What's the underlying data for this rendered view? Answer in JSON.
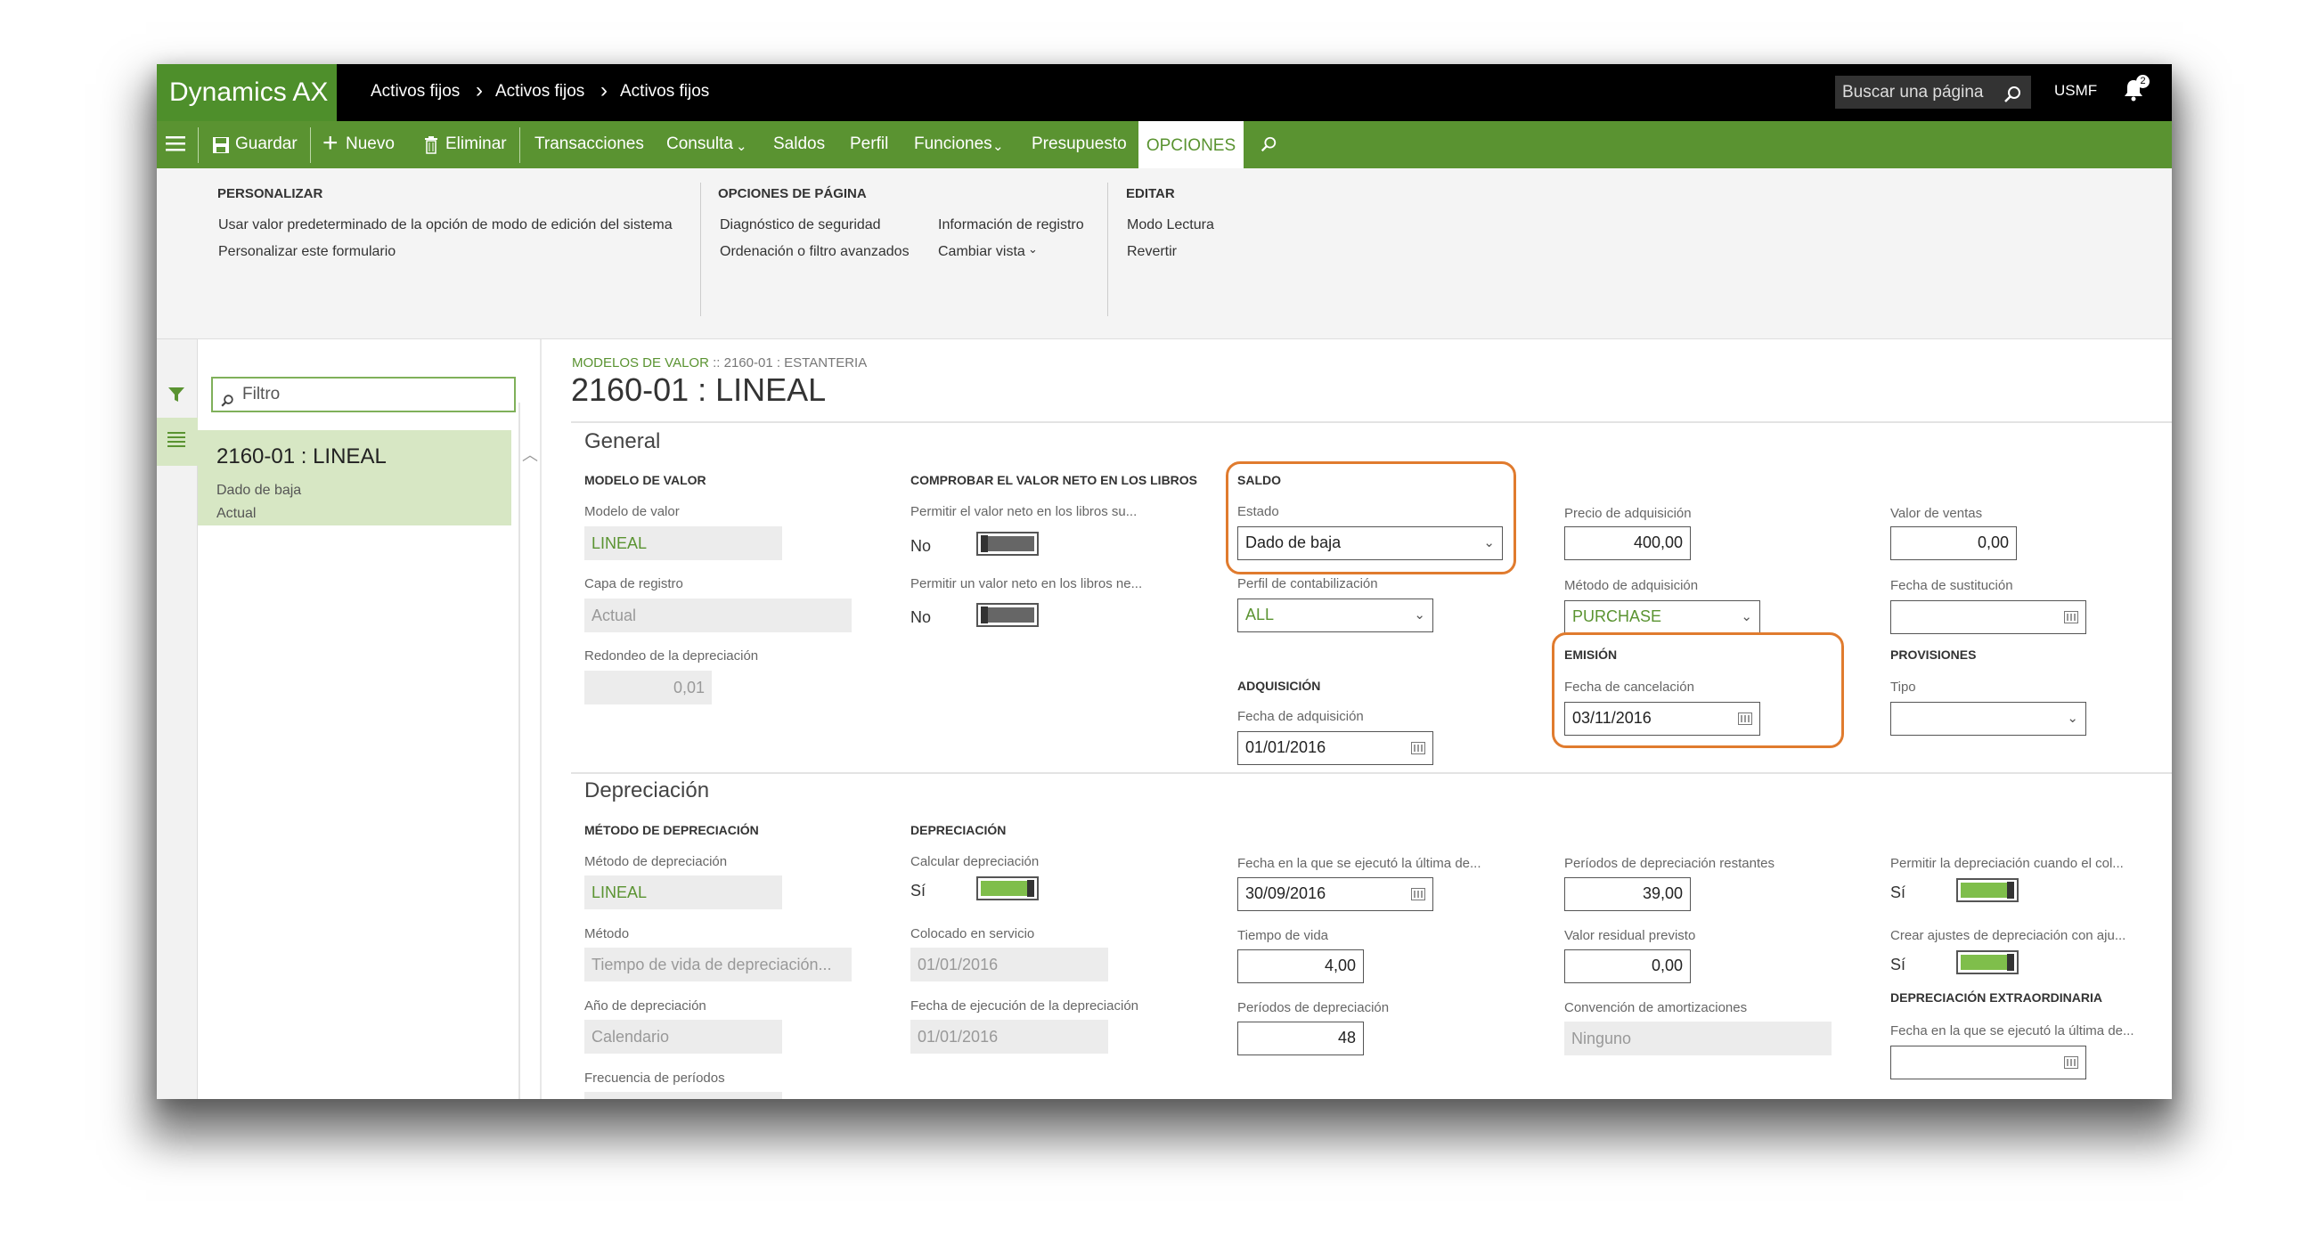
{
  "app": {
    "title": "Dynamics AX",
    "breadcrumbs": [
      "Activos fijos",
      "Activos fijos",
      "Activos fijos"
    ],
    "search_placeholder": "Buscar una página",
    "company": "USMF",
    "notification_count": "2"
  },
  "actions": {
    "save": "Guardar",
    "new": "Nuevo",
    "delete": "Eliminar",
    "transactions": "Transacciones",
    "inquiry": "Consulta",
    "balances": "Saldos",
    "profile": "Perfil",
    "functions": "Funciones",
    "budget": "Presupuesto",
    "options": "OPCIONES"
  },
  "ribbon": {
    "personalize": {
      "header": "PERSONALIZAR",
      "items": [
        "Usar valor predeterminado de la opción de modo de edición del sistema",
        "Personalizar este formulario"
      ]
    },
    "page_options": {
      "header": "OPCIONES DE PÁGINA",
      "items": [
        "Diagnóstico de seguridad",
        "Ordenación o filtro avanzados",
        "Información de registro",
        "Cambiar vista"
      ]
    },
    "edit": {
      "header": "EDITAR",
      "items": [
        "Modo Lectura",
        "Revertir"
      ]
    }
  },
  "list": {
    "filter_placeholder": "Filtro",
    "item": {
      "title": "2160-01 : LINEAL",
      "line1": "Dado de baja",
      "line2": "Actual"
    }
  },
  "form": {
    "breadcrumb_link": "MODELOS DE VALOR",
    "breadcrumb_rest": " :: 2160-01 : ESTANTERIA",
    "title": "2160-01 : LINEAL",
    "general": {
      "title": "General",
      "modelo": {
        "header": "MODELO DE VALOR",
        "modelo_label": "Modelo de valor",
        "modelo_value": "LINEAL",
        "capa_label": "Capa de registro",
        "capa_value": "Actual",
        "redondeo_label": "Redondeo de la depreciación",
        "redondeo_value": "0,01"
      },
      "comprobar": {
        "header": "COMPROBAR EL VALOR NETO EN LOS LIBROS",
        "p1_label": "Permitir el valor neto en los libros su...",
        "p1_value": "No",
        "p2_label": "Permitir un valor neto en los libros ne...",
        "p2_value": "No"
      },
      "saldo": {
        "header": "SALDO",
        "estado_label": "Estado",
        "estado_value": "Dado de baja",
        "perfil_label": "Perfil de contabilización",
        "perfil_value": "ALL"
      },
      "adquisicion": {
        "header": "ADQUISICIÓN",
        "fecha_label": "Fecha de adquisición",
        "fecha_value": "01/01/2016"
      },
      "precio": {
        "label": "Precio de adquisición",
        "value": "400,00",
        "metodo_label": "Método de adquisición",
        "metodo_value": "PURCHASE"
      },
      "emision": {
        "header": "EMISIÓN",
        "fecha_label": "Fecha de cancelación",
        "fecha_value": "03/11/2016"
      },
      "ventas": {
        "label": "Valor de ventas",
        "value": "0,00",
        "sustitucion_label": "Fecha de sustitución",
        "sustitucion_value": ""
      },
      "provisiones": {
        "header": "PROVISIONES",
        "tipo_label": "Tipo",
        "tipo_value": ""
      }
    },
    "depreciacion": {
      "title": "Depreciación",
      "metodo": {
        "header": "MÉTODO DE DEPRECIACIÓN",
        "metodo_label": "Método de depreciación",
        "metodo_value": "LINEAL",
        "m_label": "Método",
        "m_value": "Tiempo de vida de depreciación...",
        "anio_label": "Año de depreciación",
        "anio_value": "Calendario",
        "frecuencia_label": "Frecuencia de períodos"
      },
      "dep": {
        "header": "DEPRECIACIÓN",
        "calc_label": "Calcular depreciación",
        "calc_value": "Sí",
        "servicio_label": "Colocado en servicio",
        "servicio_value": "01/01/2016",
        "ejec_label": "Fecha de ejecución de la depreciación",
        "ejec_value": "01/01/2016"
      },
      "col3": {
        "ultima_label": "Fecha en la que se ejecutó la última de...",
        "ultima_value": "30/09/2016",
        "vida_label": "Tiempo de vida",
        "vida_value": "4,00",
        "periodos_label": "Períodos de depreciación",
        "periodos_value": "48"
      },
      "col4": {
        "restantes_label": "Períodos de depreciación restantes",
        "restantes_value": "39,00",
        "residual_label": "Valor residual previsto",
        "residual_value": "0,00",
        "convencion_label": "Convención de amortizaciones",
        "convencion_value": "Ninguno"
      },
      "col5": {
        "permitir_label": "Permitir la depreciación cuando el col...",
        "permitir_value": "Sí",
        "ajustes_label": "Crear ajustes de depreciación con aju...",
        "ajustes_value": "Sí",
        "extra_header": "DEPRECIACIÓN EXTRAORDINARIA",
        "extra_label": "Fecha en la que se ejecutó la última de...",
        "extra_value": ""
      }
    }
  },
  "colors": {
    "brand": "#4e8f2b",
    "actionbar": "#5a9331",
    "highlight": "#e07b2e",
    "toggle_on": "#7fbe4b"
  }
}
